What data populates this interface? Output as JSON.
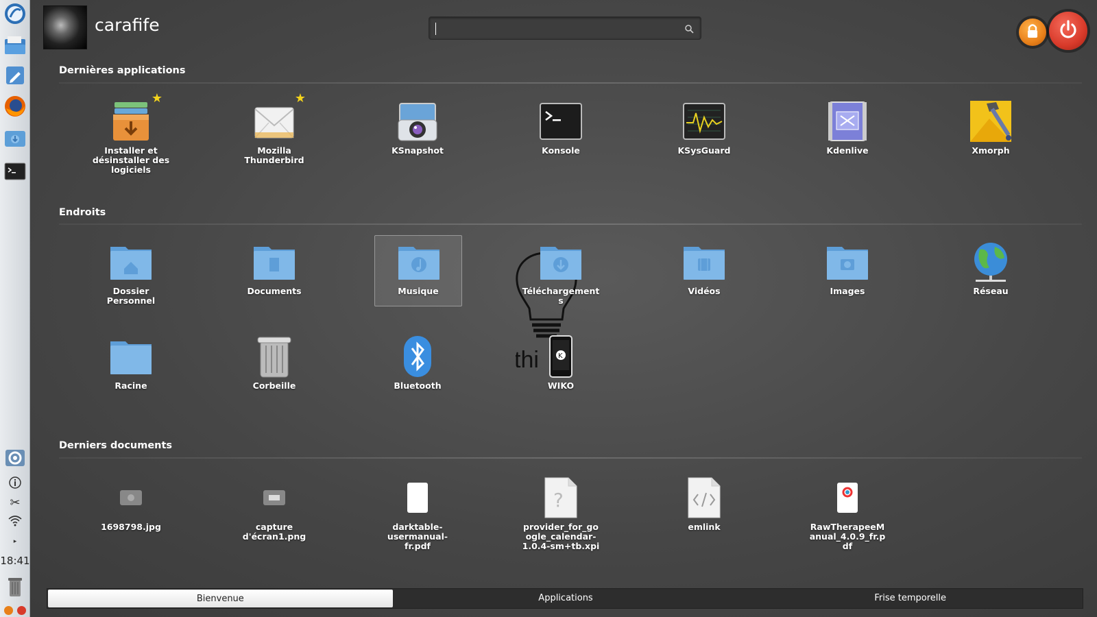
{
  "user": {
    "name": "carafife"
  },
  "search": {
    "placeholder": ""
  },
  "clock": {
    "time": "18:41"
  },
  "sections": {
    "recent_apps": {
      "title": "Dernières applications",
      "items": [
        {
          "label": "Installer et désinstaller des logiciels",
          "icon": "package-installer-icon",
          "favorite": true
        },
        {
          "label": "Mozilla Thunderbird",
          "icon": "mail-icon",
          "favorite": true
        },
        {
          "label": "KSnapshot",
          "icon": "camera-icon"
        },
        {
          "label": "Konsole",
          "icon": "terminal-icon"
        },
        {
          "label": "KSysGuard",
          "icon": "system-monitor-icon"
        },
        {
          "label": "Kdenlive",
          "icon": "video-editor-icon"
        },
        {
          "label": "Xmorph",
          "icon": "morph-icon"
        }
      ]
    },
    "places": {
      "title": "Endroits",
      "items": [
        {
          "label": "Dossier Personnel",
          "icon": "home-folder-icon"
        },
        {
          "label": "Documents",
          "icon": "documents-folder-icon"
        },
        {
          "label": "Musique",
          "icon": "music-folder-icon",
          "selected": true
        },
        {
          "label": "Téléchargements",
          "icon": "downloads-folder-icon"
        },
        {
          "label": "Vidéos",
          "icon": "videos-folder-icon"
        },
        {
          "label": "Images",
          "icon": "images-folder-icon"
        },
        {
          "label": "Réseau",
          "icon": "globe-icon"
        },
        {
          "label": "Racine",
          "icon": "root-folder-icon"
        },
        {
          "label": "Corbeille",
          "icon": "trash-icon"
        },
        {
          "label": "Bluetooth",
          "icon": "bluetooth-icon"
        },
        {
          "label": "WIKO",
          "icon": "phone-icon"
        }
      ]
    },
    "recent_docs": {
      "title": "Derniers documents",
      "items": [
        {
          "label": "1698798.jpg",
          "icon": "image-file-icon"
        },
        {
          "label": "capture d'écran1.png",
          "icon": "image-file-icon"
        },
        {
          "label": "darktable-usermanual-fr.pdf",
          "icon": "pdf-file-icon"
        },
        {
          "label": "provider_for_google_calendar-1.0.4-sm+tb.xpi",
          "icon": "unknown-file-icon"
        },
        {
          "label": "emlink",
          "icon": "code-file-icon"
        },
        {
          "label": "RawTherapeeManual_4.0.9_fr.pdf",
          "icon": "pdf-file-icon"
        }
      ]
    }
  },
  "tabs": [
    "Bienvenue",
    "Applications",
    "Frise temporelle"
  ],
  "colors": {
    "accent_orange": "#e8801a",
    "accent_red": "#d83a2a",
    "star": "#f3d31c"
  }
}
